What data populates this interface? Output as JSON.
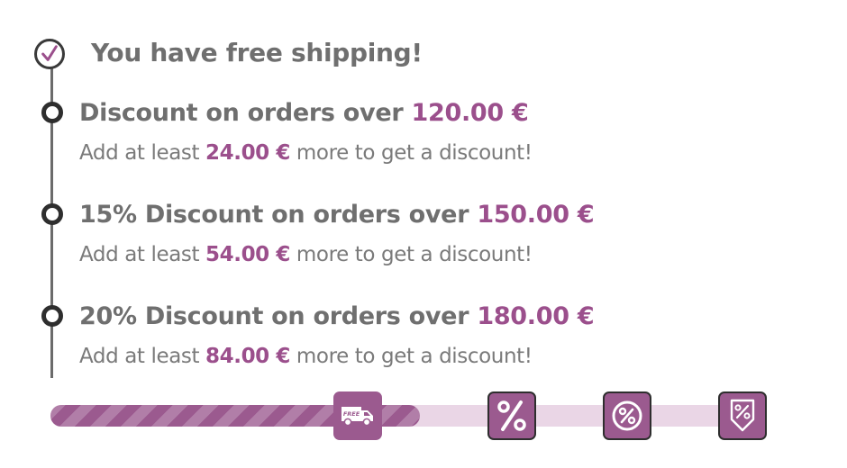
{
  "free_shipping": {
    "text": "You have free shipping!",
    "icon": "check-icon"
  },
  "tiers": [
    {
      "heading_prefix": "Discount on orders over",
      "threshold": "120.00 €",
      "sub_before": "Add at least",
      "sub_amount": "24.00 €",
      "sub_after": "more to get a discount!"
    },
    {
      "heading_prefix": "15% Discount on orders over",
      "threshold": "150.00 €",
      "sub_before": "Add at least",
      "sub_amount": "54.00 €",
      "sub_after": "more to get a discount!"
    },
    {
      "heading_prefix": "20% Discount on orders over",
      "threshold": "180.00 €",
      "sub_before": "Add at least",
      "sub_amount": "84.00 €",
      "sub_after": "more to get a discount!"
    }
  ],
  "progress": {
    "fill_fraction": 0.517,
    "milestones": [
      {
        "name": "free-shipping-truck-icon",
        "label": "FREE"
      },
      {
        "name": "percent-icon"
      },
      {
        "name": "percent-badge-icon"
      },
      {
        "name": "percent-tag-arrow-icon"
      }
    ]
  },
  "colors": {
    "accent": "#9b4f8c",
    "text": "#6f6f6f",
    "track": "#ead6e6",
    "fill": "#9b5a8f"
  }
}
